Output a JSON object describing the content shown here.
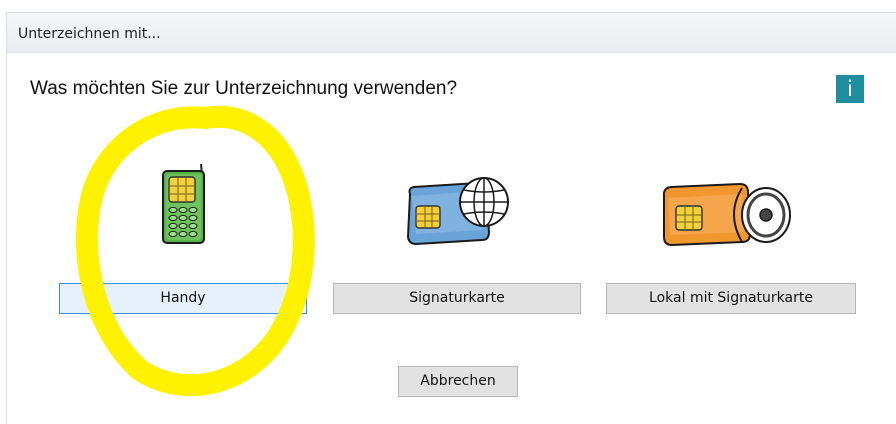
{
  "dialog": {
    "title": "Unterzeichnen mit...",
    "question": "Was möchten Sie zur Unterzeichnung verwenden?",
    "info_label": "i"
  },
  "options": [
    {
      "label": "Handy",
      "icon": "mobile-phone-icon",
      "selected": true
    },
    {
      "label": "Signaturkarte",
      "icon": "signature-card-globe-icon",
      "selected": false
    },
    {
      "label": "Lokal mit Signaturkarte",
      "icon": "signature-card-disc-icon",
      "selected": false
    }
  ],
  "cancel_label": "Abbrechen",
  "colors": {
    "info_badge": "#1f8fa0",
    "selected_border": "#3a8ee0",
    "highlight": "#fff200",
    "phone_green": "#57b24a",
    "card_blue": "#6aa3d8",
    "card_orange": "#f2962e",
    "chip_gold": "#f2cf3c"
  }
}
